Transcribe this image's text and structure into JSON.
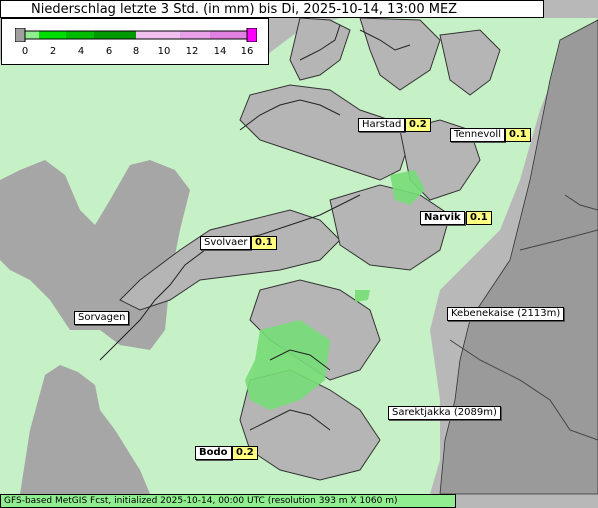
{
  "title": "Niederschlag letzte 3 Std. (in mm) bis Di, 2025-10-14, 13:00 MEZ",
  "legend": {
    "ticks": [
      "0",
      "2",
      "4",
      "6",
      "8",
      "10",
      "12",
      "14",
      "16"
    ],
    "colors": [
      "#a0a0a0",
      "#90ee90",
      "#00dd00",
      "#00bb00",
      "#009900",
      "#f0c0f0",
      "#e8a0e8",
      "#e080e0",
      "#ff00ff"
    ]
  },
  "places": [
    {
      "name": "Harstad",
      "value": "0.2",
      "bold": false
    },
    {
      "name": "Tennevoll",
      "value": "0.1",
      "bold": false
    },
    {
      "name": "Narvik",
      "value": "0.1",
      "bold": true
    },
    {
      "name": "Svolvaer",
      "value": "0.1",
      "bold": false
    },
    {
      "name": "Sorvagen",
      "value": "",
      "bold": false
    },
    {
      "name": "Kebenekaise (2113m)",
      "value": "",
      "bold": false
    },
    {
      "name": "Sarektjakka (2089m)",
      "value": "",
      "bold": false
    },
    {
      "name": "Bodo",
      "value": "0.2",
      "bold": true
    }
  ],
  "footer": "GFS-based MetGIS Fcst, initialized 2025-10-14, 00:00 UTC  (resolution 393 m X 1060 m)",
  "colors": {
    "sea": "#c8f2c8",
    "land": "#b4b4b4",
    "precip_light": "#90ee90",
    "precip_mid": "#66dd66"
  }
}
